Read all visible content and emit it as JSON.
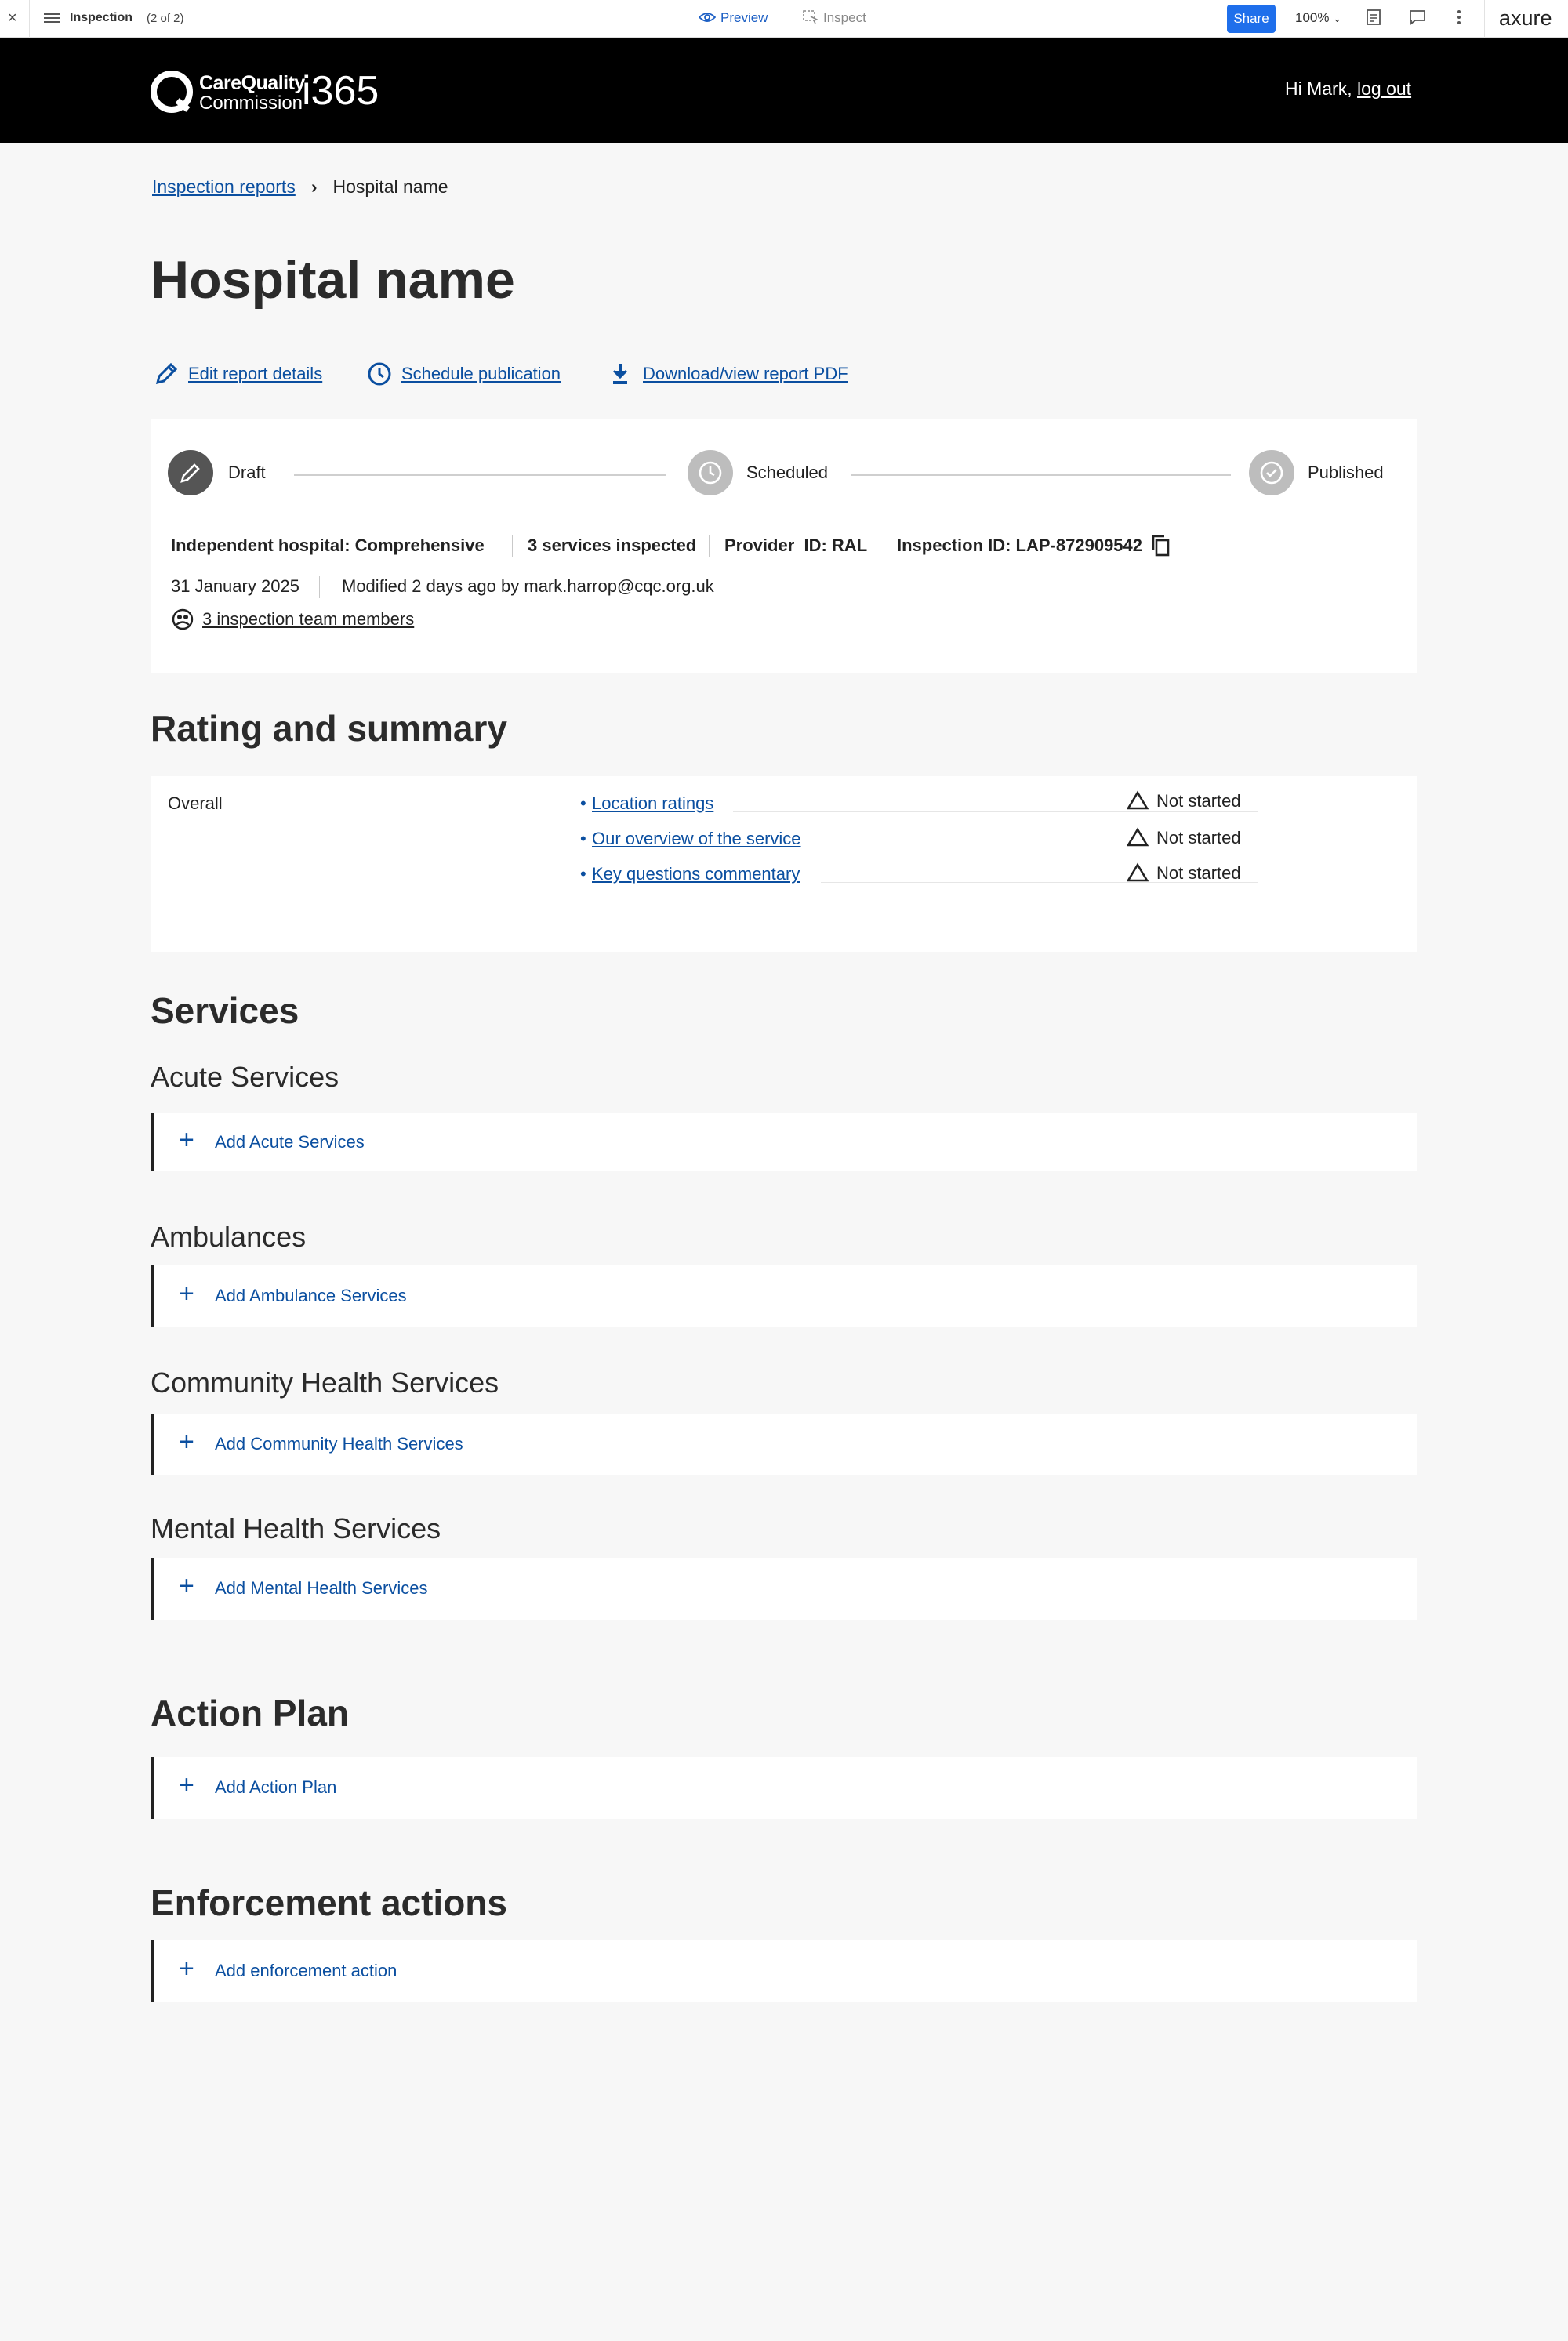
{
  "toolbar": {
    "close": "×",
    "title": "Inspection",
    "page_count": "(2 of 2)",
    "preview": "Preview",
    "inspect": "Inspect",
    "share": "Share",
    "zoom": "100%",
    "brand": "axure"
  },
  "header": {
    "org_line1": "CareQuality",
    "org_line2": "Commission",
    "app_name": "i365",
    "greeting": "Hi Mark,",
    "logout": "log out"
  },
  "breadcrumb": {
    "parent": "Inspection reports",
    "current": "Hospital name"
  },
  "page_title": "Hospital name",
  "actions": {
    "edit": "Edit report details",
    "schedule": "Schedule publication",
    "download": "Download/view report PDF"
  },
  "status_steps": [
    "Draft",
    "Scheduled",
    "Published"
  ],
  "report_meta": {
    "type": "Independent hospital: Comprehensive",
    "services": "3 services inspected",
    "provider": "Provider  ID: RAL",
    "inspection_id": "Inspection ID: LAP-872909542",
    "date": "31 January 2025",
    "modified": "Modified 2 days ago by mark.harrop@cqc.org.uk",
    "team": "3 inspection team members"
  },
  "rating_section": {
    "title": "Rating and summary",
    "row_label": "Overall",
    "items": [
      {
        "label": "Location ratings",
        "status": "Not started"
      },
      {
        "label": "Our overview of the service",
        "status": "Not started"
      },
      {
        "label": "Key questions commentary",
        "status": "Not started"
      }
    ]
  },
  "services_section": {
    "title": "Services",
    "groups": [
      {
        "title": "Acute Services",
        "add_label": "Add Acute Services"
      },
      {
        "title": "Ambulances",
        "add_label": "Add Ambulance Services"
      },
      {
        "title": "Community Health Services",
        "add_label": "Add Community Health Services"
      },
      {
        "title": "Mental Health Services",
        "add_label": "Add Mental Health Services"
      }
    ]
  },
  "action_plan": {
    "title": "Action Plan",
    "add_label": "Add Action Plan"
  },
  "enforcement": {
    "title": "Enforcement actions",
    "add_label": "Add enforcement action"
  },
  "colors": {
    "link": "#0b4fa0",
    "header_bg": "#000000",
    "share_button": "#1f6feb",
    "active_step": "#555555",
    "inactive_step": "#bdbdbd"
  }
}
